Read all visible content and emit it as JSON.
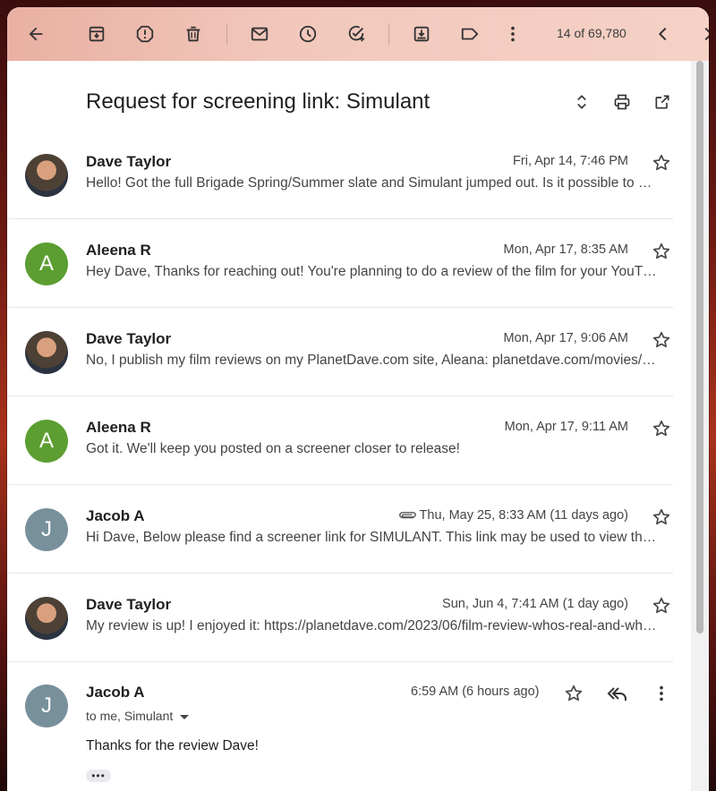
{
  "toolbar": {
    "counter": "14 of 69,780",
    "icons": [
      "back-arrow-icon",
      "archive-icon",
      "report-spam-icon",
      "delete-icon",
      "mark-unread-icon",
      "snooze-icon",
      "add-task-icon",
      "move-to-icon",
      "label-icon",
      "more-vert-icon",
      "chevron-left-icon",
      "chevron-right-icon"
    ]
  },
  "thread": {
    "subject": "Request for screening link: Simulant"
  },
  "messages": [
    {
      "sender": "Dave Taylor",
      "date": "Fri, Apr 14, 7:46 PM",
      "snippet": "Hello! Got the full Brigade Spring/Summer slate and Simulant jumped out. Is it possible to …",
      "avatar": "photo",
      "avatar_letter": ""
    },
    {
      "sender": "Aleena R",
      "date": "Mon, Apr 17, 8:35 AM",
      "snippet": "Hey Dave, Thanks for reaching out! You're planning to do a review of the film for your YouT…",
      "avatar": "green",
      "avatar_letter": "A"
    },
    {
      "sender": "Dave Taylor",
      "date": "Mon, Apr 17, 9:06 AM",
      "snippet": "No, I publish my film reviews on my PlanetDave.com site, Aleana: planetdave.com/movies/…",
      "avatar": "photo",
      "avatar_letter": ""
    },
    {
      "sender": "Aleena R",
      "date": "Mon, Apr 17, 9:11 AM",
      "snippet": "Got it. We'll keep you posted on a screener closer to release!",
      "avatar": "green",
      "avatar_letter": "A"
    },
    {
      "sender": "Jacob A",
      "date": "Thu, May 25, 8:33 AM (11 days ago)",
      "snippet": "Hi Dave, Below please find a screener link for SIMULANT. This link may be used to view th…",
      "avatar": "slate",
      "avatar_letter": "J",
      "attachment": true
    },
    {
      "sender": "Dave Taylor",
      "date": "Sun, Jun 4, 7:41 AM (1 day ago)",
      "snippet": "My review is up! I enjoyed it: https://planetdave.com/2023/06/film-review-whos-real-and-wh…",
      "avatar": "photo",
      "avatar_letter": ""
    }
  ],
  "open_message": {
    "sender": "Jacob A",
    "avatar_letter": "J",
    "date": "6:59 AM (6 hours ago)",
    "to_line": "to me, Simulant",
    "body": "Thanks for the review Dave!",
    "trimmed_label": "•••"
  }
}
